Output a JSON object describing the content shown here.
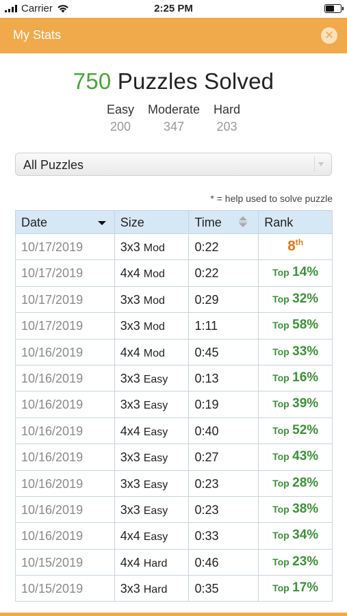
{
  "status_bar": {
    "carrier": "Carrier",
    "time": "2:25 PM"
  },
  "nav": {
    "title": "My Stats",
    "close_icon": "close-circle-icon",
    "bar_color": "#f0a94b"
  },
  "summary": {
    "solved_count": "750",
    "solved_label": " Puzzles Solved",
    "easy_label": "Easy",
    "easy_count": "200",
    "moderate_label": "Moderate",
    "moderate_count": "347",
    "hard_label": "Hard",
    "hard_count": "203"
  },
  "filter": {
    "selected": "All Puzzles"
  },
  "note": "* = help used to solve puzzle",
  "table": {
    "headers": {
      "date": "Date",
      "size": "Size",
      "time": "Time",
      "rank": "Rank"
    },
    "rows": [
      {
        "date": "10/17/2019",
        "grid": "3x3",
        "level": "Mod",
        "time": "0:22",
        "rank_place": "8",
        "rank_suffix": "th"
      },
      {
        "date": "10/17/2019",
        "grid": "4x4",
        "level": "Mod",
        "time": "0:22",
        "rank_prefix": "Top",
        "rank_pct": "14%"
      },
      {
        "date": "10/17/2019",
        "grid": "3x3",
        "level": "Mod",
        "time": "0:29",
        "rank_prefix": "Top",
        "rank_pct": "32%"
      },
      {
        "date": "10/17/2019",
        "grid": "3x3",
        "level": "Mod",
        "time": "1:11",
        "rank_prefix": "Top",
        "rank_pct": "58%"
      },
      {
        "date": "10/16/2019",
        "grid": "4x4",
        "level": "Mod",
        "time": "0:45",
        "rank_prefix": "Top",
        "rank_pct": "33%"
      },
      {
        "date": "10/16/2019",
        "grid": "3x3",
        "level": "Easy",
        "time": "0:13",
        "rank_prefix": "Top",
        "rank_pct": "16%"
      },
      {
        "date": "10/16/2019",
        "grid": "3x3",
        "level": "Easy",
        "time": "0:19",
        "rank_prefix": "Top",
        "rank_pct": "39%"
      },
      {
        "date": "10/16/2019",
        "grid": "4x4",
        "level": "Easy",
        "time": "0:40",
        "rank_prefix": "Top",
        "rank_pct": "52%"
      },
      {
        "date": "10/16/2019",
        "grid": "3x3",
        "level": "Easy",
        "time": "0:27",
        "rank_prefix": "Top",
        "rank_pct": "43%"
      },
      {
        "date": "10/16/2019",
        "grid": "3x3",
        "level": "Easy",
        "time": "0:23",
        "rank_prefix": "Top",
        "rank_pct": "28%"
      },
      {
        "date": "10/16/2019",
        "grid": "3x3",
        "level": "Easy",
        "time": "0:23",
        "rank_prefix": "Top",
        "rank_pct": "38%"
      },
      {
        "date": "10/16/2019",
        "grid": "4x4",
        "level": "Easy",
        "time": "0:33",
        "rank_prefix": "Top",
        "rank_pct": "34%"
      },
      {
        "date": "10/15/2019",
        "grid": "4x4",
        "level": "Hard",
        "time": "0:46",
        "rank_prefix": "Top",
        "rank_pct": "23%"
      },
      {
        "date": "10/15/2019",
        "grid": "3x3",
        "level": "Hard",
        "time": "0:35",
        "rank_prefix": "Top",
        "rank_pct": "17%"
      }
    ]
  },
  "colors": {
    "accent": "#f0a94b",
    "solved_count": "#4aa33a",
    "rank_top": "#3e8f3a",
    "rank_place": "#e07a1a",
    "header_bg": "#d6e7f5"
  }
}
